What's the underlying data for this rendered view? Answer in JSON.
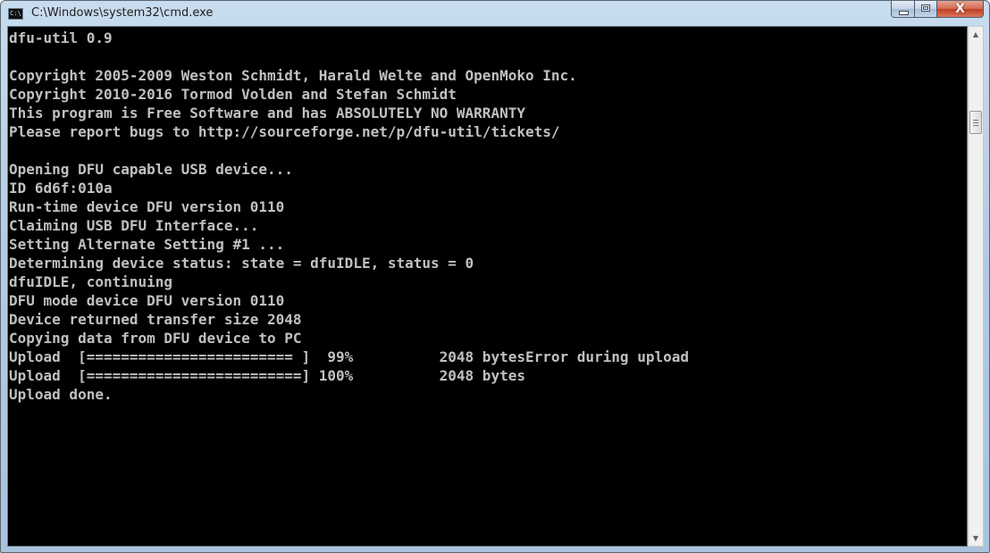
{
  "window": {
    "title": "C:\\Windows\\system32\\cmd.exe",
    "icon": "console-icon",
    "icon_label": "C:\\"
  },
  "caption_buttons": {
    "minimize": "minimize-icon",
    "maximize": "maximize-icon",
    "close": "close-icon",
    "close_glyph": "X"
  },
  "scrollbar": {
    "up_arrow": "▲",
    "down_arrow": "▼"
  },
  "colors": {
    "console_background": "#000000",
    "console_text": "#c0c0c0",
    "close_button": "#c23e20"
  },
  "console": {
    "lines": [
      "dfu-util 0.9",
      "",
      "Copyright 2005-2009 Weston Schmidt, Harald Welte and OpenMoko Inc.",
      "Copyright 2010-2016 Tormod Volden and Stefan Schmidt",
      "This program is Free Software and has ABSOLUTELY NO WARRANTY",
      "Please report bugs to http://sourceforge.net/p/dfu-util/tickets/",
      "",
      "Opening DFU capable USB device...",
      "ID 6d6f:010a",
      "Run-time device DFU version 0110",
      "Claiming USB DFU Interface...",
      "Setting Alternate Setting #1 ...",
      "Determining device status: state = dfuIDLE, status = 0",
      "dfuIDLE, continuing",
      "DFU mode device DFU version 0110",
      "Device returned transfer size 2048",
      "Copying data from DFU device to PC",
      "Upload  [======================== ]  99%          2048 bytesError during upload",
      "Upload  [=========================] 100%          2048 bytes",
      "Upload done.",
      ""
    ]
  }
}
